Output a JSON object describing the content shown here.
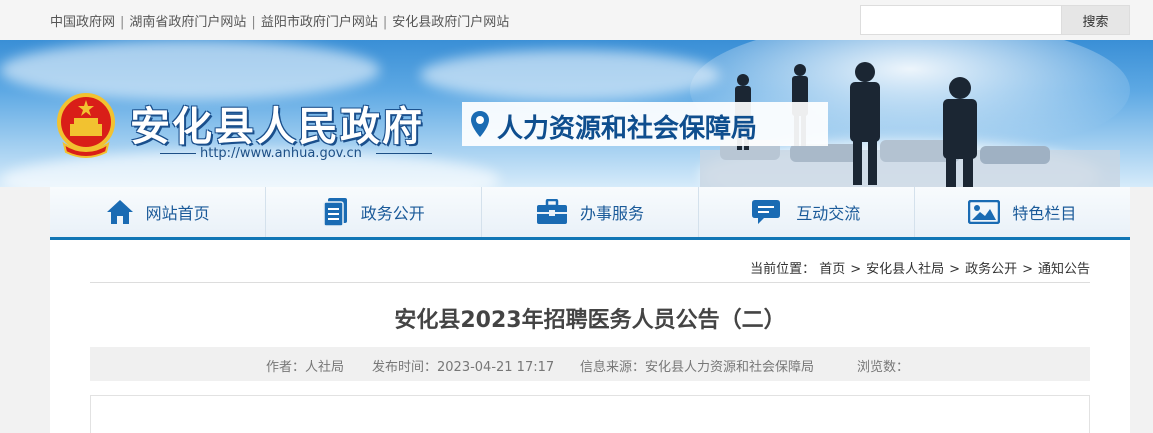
{
  "topbar": {
    "links": [
      "中国政府网",
      "湖南省政府门户网站",
      "益阳市政府门户网站",
      "安化县政府门户网站"
    ],
    "search_placeholder": "",
    "search_label": "搜索"
  },
  "banner": {
    "gov_title": "安化县人民政府",
    "gov_url": "http://www.anhua.gov.cn",
    "dept_name": "人力资源和社会保障局"
  },
  "nav": {
    "items": [
      {
        "label": "网站首页",
        "icon": "home-icon"
      },
      {
        "label": "政务公开",
        "icon": "document-icon"
      },
      {
        "label": "办事服务",
        "icon": "briefcase-icon"
      },
      {
        "label": "互动交流",
        "icon": "chat-icon"
      },
      {
        "label": "特色栏目",
        "icon": "image-icon"
      }
    ]
  },
  "breadcrumb": {
    "prefix": "当前位置：",
    "items": [
      "首页",
      "安化县人社局",
      "政务公开",
      "通知公告"
    ]
  },
  "article": {
    "title": "安化县2023年招聘医务人员公告（二）",
    "author": "作者：人社局",
    "publish_time": "发布时间：2023-04-21 17:17",
    "source": "信息来源：安化县人力资源和社会保障局",
    "views": "浏览数："
  },
  "colors": {
    "nav_text": "#1a5a99",
    "nav_border": "#1176b5",
    "dept_text": "#0f4e8e"
  }
}
